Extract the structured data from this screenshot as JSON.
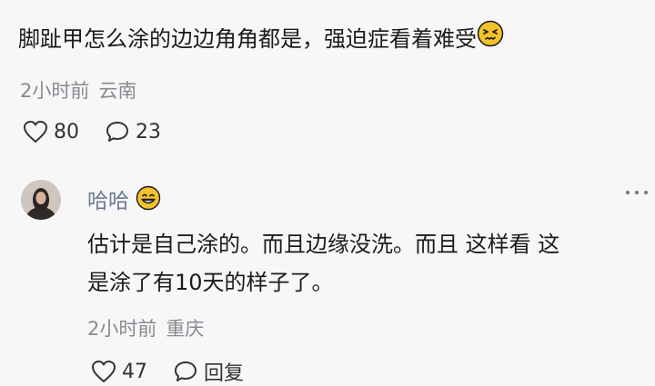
{
  "comment": {
    "text": "脚趾甲怎么涂的边边角角都是，强迫症看着难受",
    "emoji": "persevering-face-emoji",
    "time": "2小时前",
    "location": "云南",
    "likes": "80",
    "replies": "23"
  },
  "reply": {
    "author": "哈哈",
    "author_emoji": "grinning-face-emoji",
    "line1": "估计是自己涂的。而且边缘没洗。而且 这样看 这",
    "line2": "是涂了有10天的样子了。",
    "time": "2小时前",
    "location": "重庆",
    "likes": "47",
    "reply_label": "回复"
  },
  "colors": {
    "background": "#f7f7f9",
    "meta_text": "#8a8a8e",
    "author_name": "#6b7a8f",
    "emoji_yellow": "#f3c12d"
  }
}
